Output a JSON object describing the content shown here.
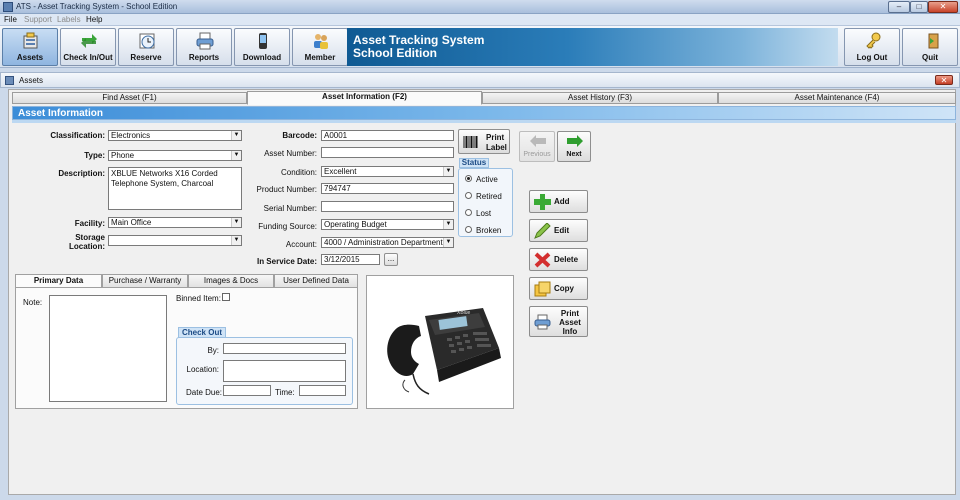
{
  "window": {
    "title": "ATS - Asset Tracking System - School Edition",
    "controls": [
      "–",
      "□",
      "✕"
    ]
  },
  "menu": {
    "file": "File",
    "support": "Support",
    "labels": "Labels",
    "help": "Help"
  },
  "toolbar": {
    "assets": "Assets",
    "checkinout": "Check In/Out",
    "reserve": "Reserve",
    "reports": "Reports",
    "download": "Download",
    "member": "Member",
    "logout": "Log Out",
    "quit": "Quit"
  },
  "banner": {
    "line1": "Asset Tracking System",
    "line2": "School Edition"
  },
  "subwindow": {
    "title": "Assets",
    "close": "✕"
  },
  "tabs": [
    "Find Asset (F1)",
    "Asset Information (F2)",
    "Asset History (F3)",
    "Asset Maintenance (F4)"
  ],
  "section": {
    "title": "Asset Information"
  },
  "form": {
    "classification_label": "Classification:",
    "classification": "Electronics",
    "type_label": "Type:",
    "type": "Phone",
    "description_label": "Description:",
    "description": "XBLUE Networks X16 Corded Telephone System, Charcoal",
    "facility_label": "Facility:",
    "facility": "Main Office",
    "storage_label1": "Storage",
    "storage_label2": "Location:",
    "storage": "",
    "barcode_label": "Barcode:",
    "barcode": "A0001",
    "assetnum_label": "Asset Number:",
    "assetnum": "",
    "condition_label": "Condition:",
    "condition": "Excellent",
    "productnum_label": "Product Number:",
    "productnum": "794747",
    "serial_label": "Serial Number:",
    "serial": "",
    "funding_label": "Funding Source:",
    "funding": "Operating Budget",
    "account_label": "Account:",
    "account": "4000 / Administration Department",
    "inservice_label": "In Service Date:",
    "inservice": "3/12/2015",
    "date_btn": "..."
  },
  "print_label": {
    "line1": "Print",
    "line2": "Label"
  },
  "status": {
    "title": "Status",
    "options": [
      "Active",
      "Retired",
      "Lost",
      "Broken"
    ],
    "selected": "Active"
  },
  "nav": {
    "previous": "Previous",
    "next": "Next"
  },
  "actions": {
    "add": "Add",
    "edit": "Edit",
    "delete": "Delete",
    "copy": "Copy",
    "print_line1": "Print",
    "print_line2": "Asset",
    "print_line3": "Info"
  },
  "subtabs": [
    "Primary Data",
    "Purchase / Warranty",
    "Images & Docs",
    "User Defined Data"
  ],
  "primary": {
    "note_label": "Note:",
    "note": "",
    "binned_label": "Binned Item:",
    "binned": false,
    "checkout_title": "Check Out",
    "by_label": "By:",
    "by": "",
    "location_label": "Location:",
    "location": "",
    "datedue_label": "Date Due:",
    "datedue": "",
    "time_label": "Time:",
    "time": ""
  },
  "image": {
    "brand": "XBlue"
  }
}
